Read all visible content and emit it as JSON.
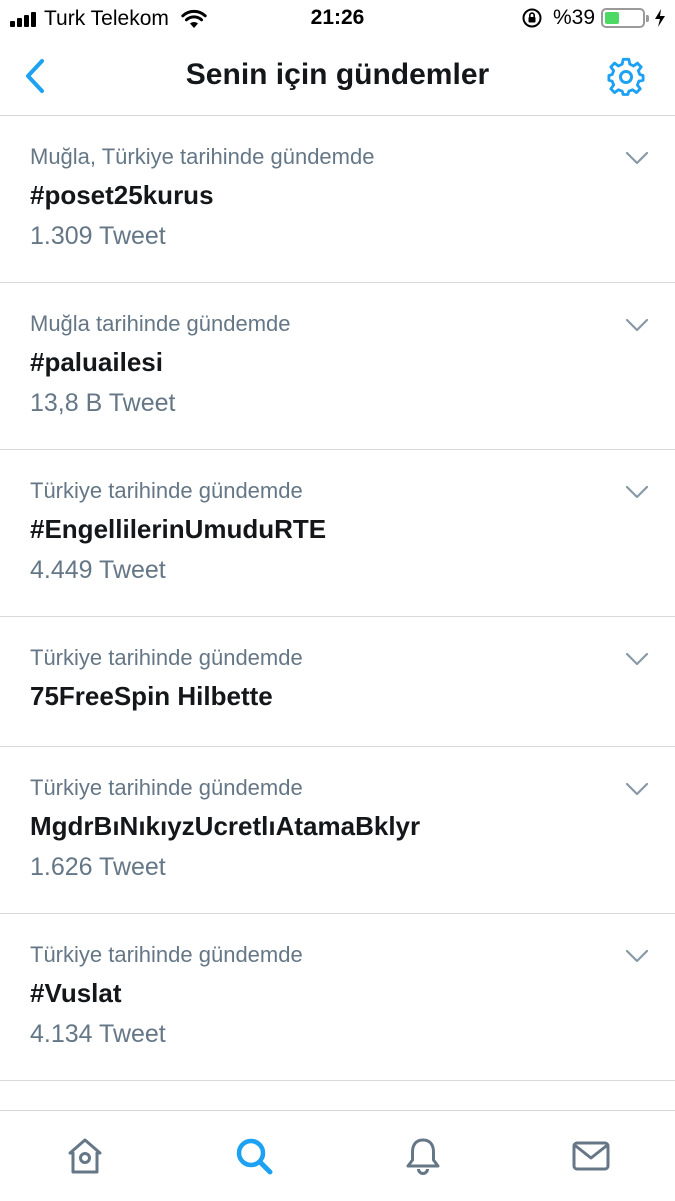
{
  "status_bar": {
    "carrier": "Turk Telekom",
    "time": "21:26",
    "battery_percent": "%39",
    "battery_level": 0.39
  },
  "header": {
    "title": "Senin için gündemler",
    "back_icon": "chevron-left-icon",
    "settings_icon": "gear-icon"
  },
  "colors": {
    "accent": "#1da1f2",
    "secondary_text": "#657786",
    "primary_text": "#14171a",
    "battery": "#4cd964"
  },
  "trends": [
    {
      "context": "Muğla, Türkiye tarihinde gündemde",
      "name": "#poset25kurus",
      "count": "1.309 Tweet"
    },
    {
      "context": "Muğla tarihinde gündemde",
      "name": "#paluailesi",
      "count": "13,8 B Tweet"
    },
    {
      "context": "Türkiye tarihinde gündemde",
      "name": "#EngellilerinUmuduRTE",
      "count": "4.449 Tweet"
    },
    {
      "context": "Türkiye tarihinde gündemde",
      "name": "75FreeSpin Hilbette",
      "count": ""
    },
    {
      "context": "Türkiye tarihinde gündemde",
      "name": "MgdrBıNıkıyzUcretlıAtamaBklyr",
      "count": "1.626 Tweet"
    },
    {
      "context": "Türkiye tarihinde gündemde",
      "name": "#Vuslat",
      "count": "4.134 Tweet"
    }
  ],
  "tab_bar": {
    "tabs": [
      {
        "icon": "home-icon",
        "active": false
      },
      {
        "icon": "search-icon",
        "active": true
      },
      {
        "icon": "bell-icon",
        "active": false
      },
      {
        "icon": "mail-icon",
        "active": false
      }
    ]
  }
}
